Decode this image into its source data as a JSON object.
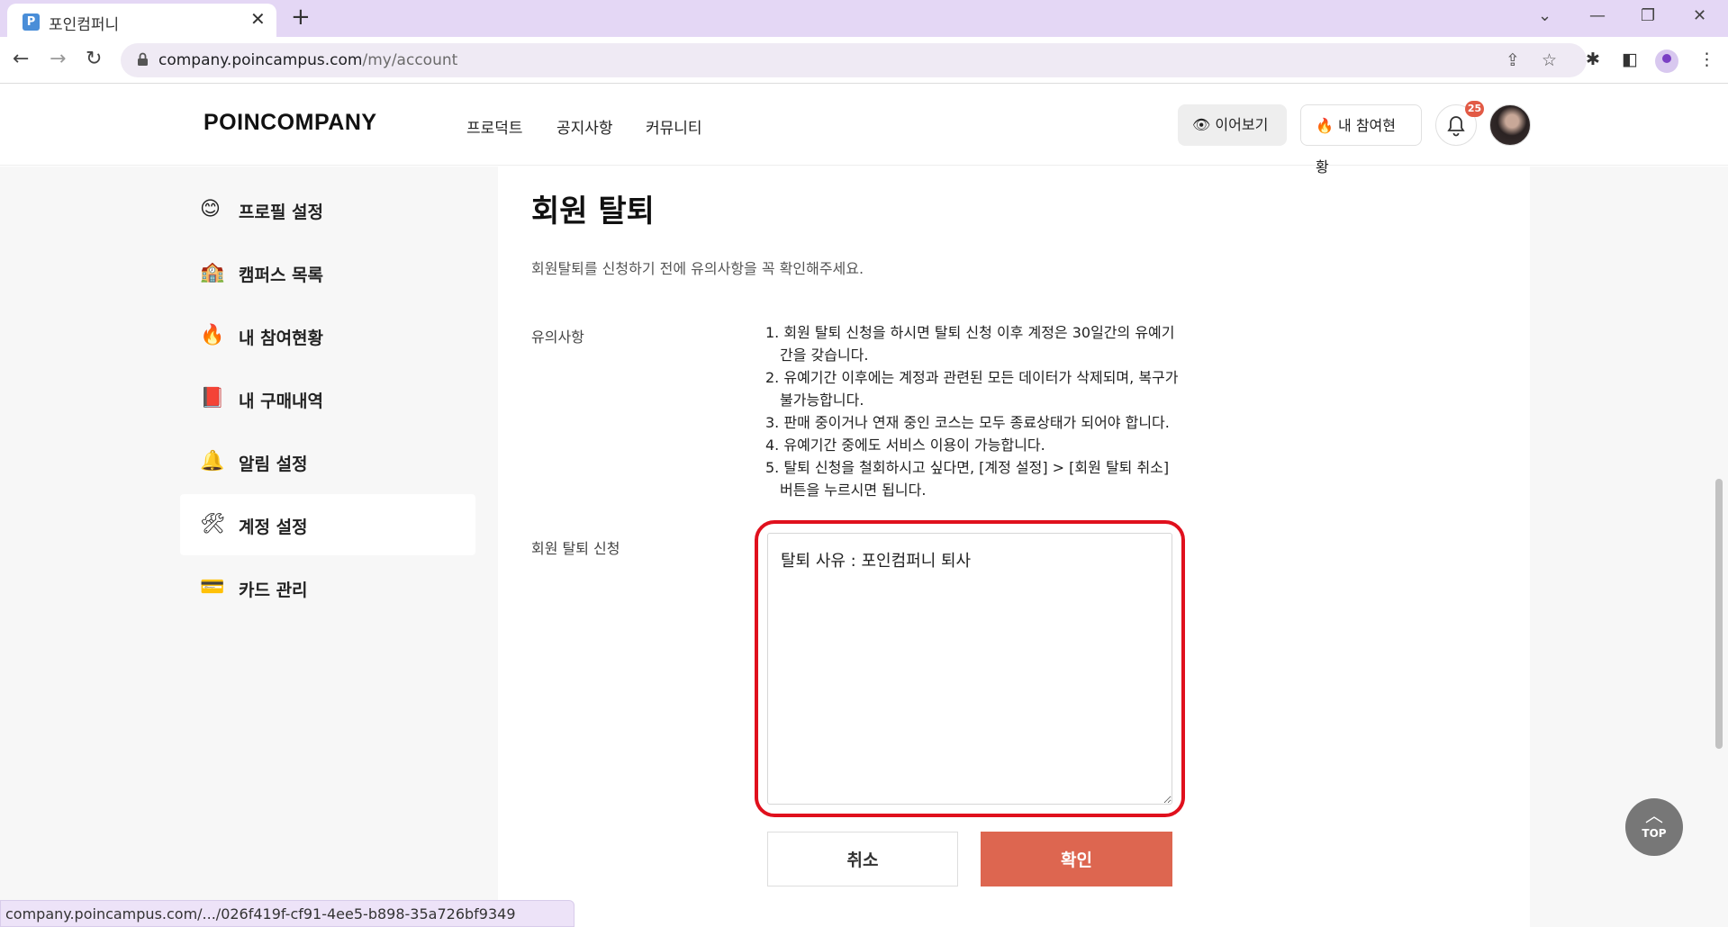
{
  "browser": {
    "tab_title": "포인컴퍼니",
    "favicon_letter": "P",
    "url_domain": "company.poincampus.com",
    "url_path": "/my/account",
    "status_url": "company.poincampus.com/.../026f419f-cf91-4ee5-b898-35a726bf9349"
  },
  "header": {
    "logo": "POINCOMPANY",
    "nav": [
      "프로덕트",
      "공지사항",
      "커뮤니티"
    ],
    "continue_label": "이어보기",
    "participation_label": "내 참여현황",
    "notification_count": "25"
  },
  "sidebar": {
    "items": [
      {
        "icon": "😊",
        "label": "프로필 설정",
        "active": false
      },
      {
        "icon": "🏫",
        "label": "캠퍼스 목록",
        "active": false
      },
      {
        "icon": "🔥",
        "label": "내 참여현황",
        "active": false
      },
      {
        "icon": "📕",
        "label": "내 구매내역",
        "active": false
      },
      {
        "icon": "🔔",
        "label": "알림 설정",
        "active": false
      },
      {
        "icon": "🛠",
        "label": "계정 설정",
        "active": true
      },
      {
        "icon": "💳",
        "label": "카드 관리",
        "active": false
      }
    ]
  },
  "main": {
    "title": "회원 탈퇴",
    "subtitle": "회원탈퇴를 신청하기 전에 유의사항을 꼭 확인해주세요.",
    "notice_label": "유의사항",
    "notices": [
      "1. 회원 탈퇴 신청을 하시면 탈퇴 신청 이후 계정은 30일간의 유예기간을 갖습니다.",
      "2. 유예기간 이후에는 계정과 관련된 모든 데이터가 삭제되며, 복구가 불가능합니다.",
      "3. 판매 중이거나 연재 중인 코스는 모두 종료상태가 되어야 합니다.",
      "4. 유예기간 중에도 서비스 이용이 가능합니다.",
      "5. 탈퇴 신청을 철회하시고 싶다면, [계정 설정] > [회원 탈퇴 취소] 버튼을 누르시면 됩니다."
    ],
    "request_label": "회원 탈퇴 신청",
    "reason_value": "탈퇴 사유 : 포인컴퍼니 퇴사",
    "cancel_label": "취소",
    "confirm_label": "확인"
  },
  "top_button_label": "TOP",
  "colors": {
    "accent": "#dd6650",
    "highlight": "#e0101d",
    "tabbar": "#e4d7f5"
  }
}
